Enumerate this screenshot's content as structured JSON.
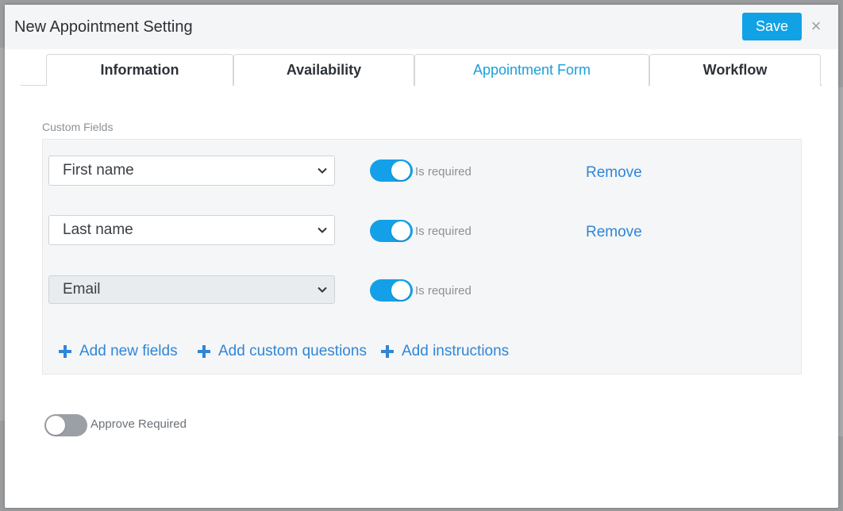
{
  "modal": {
    "title": "New Appointment Setting",
    "save_label": "Save",
    "close_glyph": "×"
  },
  "tabs": [
    {
      "label": "Information",
      "active": false
    },
    {
      "label": "Availability",
      "active": false
    },
    {
      "label": "Appointment Form",
      "active": true
    },
    {
      "label": "Workflow",
      "active": false
    }
  ],
  "custom_fields": {
    "section_label": "Custom Fields",
    "rows": [
      {
        "field": "First name",
        "required_label": "Is required",
        "required": true,
        "remove_label": "Remove",
        "disabled": false
      },
      {
        "field": "Last name",
        "required_label": "Is required",
        "required": true,
        "remove_label": "Remove",
        "disabled": false
      },
      {
        "field": "Email",
        "required_label": "Is required",
        "required": true,
        "disabled": true
      }
    ],
    "actions": [
      {
        "label": "Add new fields"
      },
      {
        "label": "Add custom questions"
      },
      {
        "label": "Add instructions"
      }
    ]
  },
  "approve": {
    "label": "Approve Required",
    "enabled": false
  },
  "colors": {
    "accent": "#11a2e6",
    "link": "#2f86d8",
    "toggle_off": "#9aa0a6"
  },
  "icons": {
    "close": "close-icon",
    "chevron": "chevron-down-icon",
    "plus": "plus-icon"
  }
}
